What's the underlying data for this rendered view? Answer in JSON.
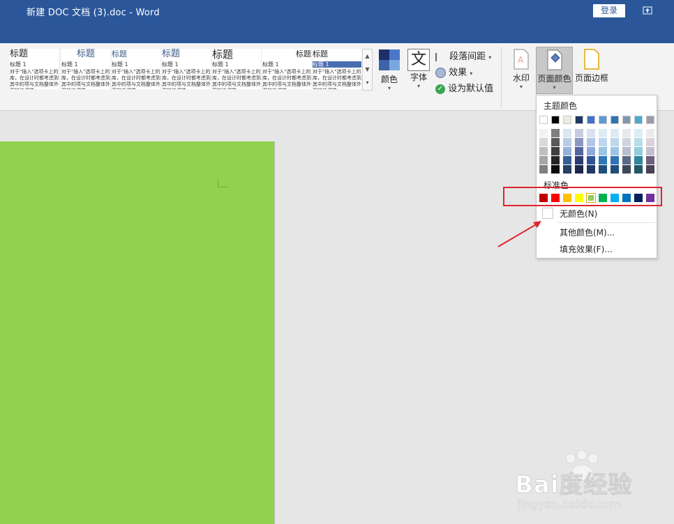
{
  "window": {
    "title": "新建 DOC 文档 (3).doc  -  Word",
    "login_label": "登录"
  },
  "styles_gallery": [
    {
      "heading": "标题",
      "sub": "标题 1",
      "text": "对于\"插入\"选项卡上的库，在设计时都考虑到其中的项与文档整体外观的协调性。"
    },
    {
      "heading": "标题",
      "sub": "标题 1",
      "text": "对于\"插入\"选项卡上的库，在设计时都考虑到其中的项与文档整体外观的协调性。"
    },
    {
      "heading": "标题",
      "sub": "标题 1",
      "text": "对于\"插入\"选项卡上的库，在设计时都考虑到其中的项与文档整体外观的协调性。"
    },
    {
      "heading": "标题",
      "sub": "标题 1",
      "text": "对于\"插入\"选项卡上的库，在设计时都考虑到其中的项与文档整体外观的协调性。"
    },
    {
      "heading": "标题",
      "sub": "标题 1",
      "text": "对于\"插入\"选项卡上的库，在设计时都考虑到其中的项与文档整体外观的协调性。"
    },
    {
      "heading": "标题",
      "sub": "标题 1",
      "text": "对于\"插入\"选项卡上的库，在设计时都考虑到其中的项与文档整体外观的协调性。"
    },
    {
      "heading": "标题",
      "sub": "标题 1",
      "text": "对于\"插入\"选项卡上的库，在设计时都考虑到其中的项与文档整体外观的协调性。"
    }
  ],
  "ribbon": {
    "colors_label": "颜色",
    "fonts_label": "字体",
    "paragraph_spacing_label": "段落间距",
    "effects_label": "效果",
    "set_default_label": "设为默认值",
    "watermark_label": "水印",
    "page_color_label": "页面颜色",
    "page_borders_label": "页面边框",
    "fonts_glyph": "文"
  },
  "page_color_menu": {
    "theme_colors_heading": "主题颜色",
    "standard_colors_heading": "标准色",
    "no_color_label": "无颜色(N)",
    "more_colors_label": "其他颜色(M)...",
    "fill_effects_label": "填充效果(F)...",
    "theme_top_row": [
      "#ffffff",
      "#000000",
      "#eeece1",
      "#1f3864",
      "#4472c4",
      "#5b9bd5",
      "#2e75b6",
      "#8497b0",
      "#4bacc6",
      "#9e9aab"
    ],
    "theme_columns": [
      [
        "#f2f2f2",
        "#d9d9d9",
        "#bfbfbf",
        "#a6a6a6",
        "#808080"
      ],
      [
        "#7f7f7f",
        "#595959",
        "#3f3f3f",
        "#262626",
        "#0d0d0d"
      ],
      [
        "#dbe5f1",
        "#b8cce4",
        "#95b3d7",
        "#366092",
        "#244062"
      ],
      [
        "#c6cbe0",
        "#8d97c1",
        "#5565a2",
        "#2c3b70",
        "#1c274a"
      ],
      [
        "#d9e1f2",
        "#b4c6e7",
        "#8eaadb",
        "#2f5496",
        "#1f3864"
      ],
      [
        "#ddebf7",
        "#bdd7ee",
        "#9dc3e6",
        "#2e75b6",
        "#1f4e79"
      ],
      [
        "#deebf7",
        "#bdd7ee",
        "#9dc3e6",
        "#2e75b6",
        "#1f4e79"
      ],
      [
        "#e7e9ee",
        "#d0d4de",
        "#b8bfcd",
        "#5c6a87",
        "#3d475a"
      ],
      [
        "#daeef3",
        "#b7dee8",
        "#92cddc",
        "#31859c",
        "#215967"
      ],
      [
        "#ece9ef",
        "#d9d3de",
        "#c6bdce",
        "#6f617e",
        "#4a4154"
      ]
    ],
    "standard_colors": [
      "#c00000",
      "#ff0000",
      "#ffc000",
      "#ffff00",
      "#92d050",
      "#00b050",
      "#00b0f0",
      "#0070c0",
      "#002060",
      "#7030a0"
    ],
    "selected_standard_index": 4
  },
  "watermark_text": {
    "brand": "Bai度经验",
    "url": "jingyan.baidu.com"
  }
}
